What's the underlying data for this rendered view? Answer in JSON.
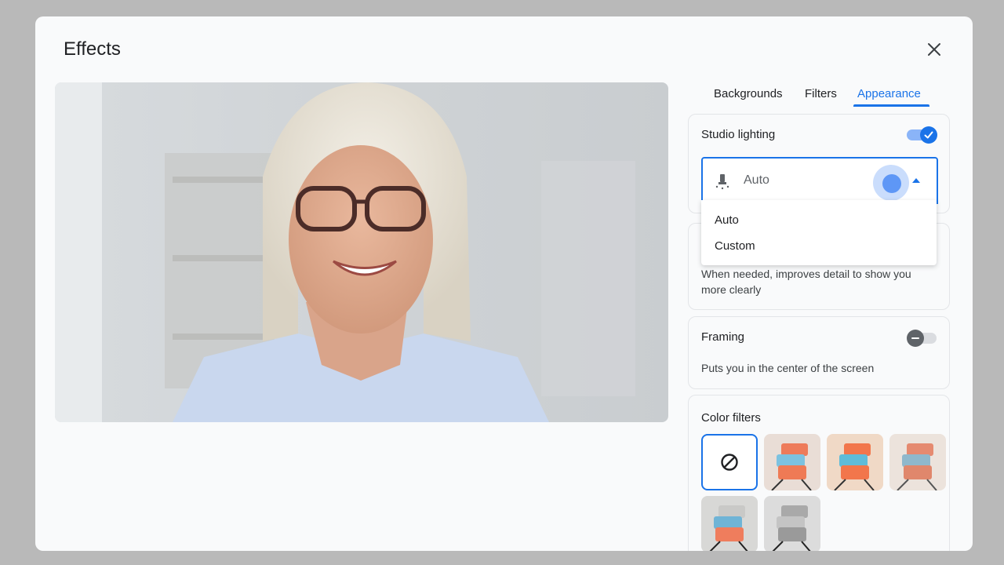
{
  "dialog": {
    "title": "Effects"
  },
  "tabs": [
    {
      "label": "Backgrounds"
    },
    {
      "label": "Filters"
    },
    {
      "label": "Appearance"
    }
  ],
  "studio_lighting": {
    "title": "Studio lighting",
    "enabled": true,
    "selected": "Auto",
    "menu_options": [
      "Auto",
      "Custom"
    ]
  },
  "studio_look": {
    "description": "When needed, improves detail to show you more clearly"
  },
  "framing": {
    "title": "Framing",
    "enabled": false,
    "description": "Puts you in the center of the screen"
  },
  "color_filters": {
    "title": "Color filters",
    "selected": "none"
  },
  "icons": {
    "close": "close-icon",
    "lighting": "lamp-icon",
    "dropdown": "caret-up-icon",
    "none": "no-filter-icon",
    "check": "check-icon",
    "minus": "minus-icon"
  },
  "colors": {
    "accent": "#1a73e8",
    "accent_light": "#8ab4f8",
    "dialog_bg": "#f9fafb",
    "backdrop": "#b9b9b9"
  }
}
